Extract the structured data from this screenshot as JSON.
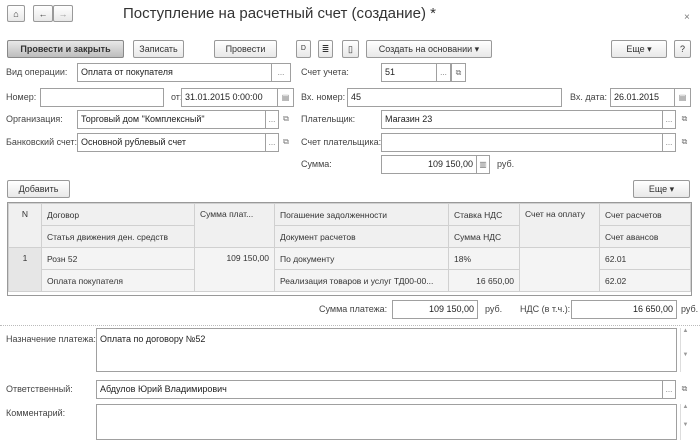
{
  "window": {
    "title": "Поступление на расчетный счет (создание) *",
    "close": "×"
  },
  "nav": {
    "home": "⌂",
    "back": "←",
    "forward": "→"
  },
  "toolbar": {
    "post_close": "Провести и закрыть",
    "save": "Записать",
    "post": "Провести",
    "create_based": "Создать на основании",
    "more": "Еще",
    "help": "?"
  },
  "form": {
    "operation_label": "Вид операции:",
    "operation": "Оплата от покупателя",
    "account_label": "Счет учета:",
    "account": "51",
    "number_label": "Номер:",
    "number": "",
    "from_label": "от:",
    "date": "31.01.2015  0:00:00",
    "in_number_label": "Вх. номер:",
    "in_number": "45",
    "in_date_label": "Вх. дата:",
    "in_date": "26.01.2015",
    "org_label": "Организация:",
    "org": "Торговый дом \"Комплексный\"",
    "payer_label": "Плательщик:",
    "payer": "Магазин 23",
    "bank_label": "Банковский счет:",
    "bank": "Основной рублевый счет",
    "payer_account_label": "Счет плательщика:",
    "payer_account": "",
    "sum_label": "Сумма:",
    "sum": "109 150,00",
    "currency": "руб."
  },
  "table_toolbar": {
    "add": "Добавить",
    "more": "Еще"
  },
  "table": {
    "headers": [
      [
        "N",
        "Договор",
        "Сумма плат...",
        "Погашение задолженности",
        "Ставка НДС",
        "Счет на оплату",
        "Счет расчетов"
      ],
      [
        "",
        "Статья движения ден. средств",
        "",
        "Документ расчетов",
        "Сумма НДС",
        "",
        "Счет авансов"
      ]
    ],
    "rows": [
      {
        "n": "1",
        "contract": "Розн 52",
        "amount": "109 150,00",
        "repayment": "По документу",
        "vat_rate": "18%",
        "invoice": "",
        "account": "62.01",
        "cashflow": "Оплата покупателя",
        "document": "Реализация товаров и услуг ТД00-00...",
        "vat_sum": "16 650,00",
        "advance_account": "62.02"
      }
    ]
  },
  "totals": {
    "payment_label": "Сумма платежа:",
    "payment": "109 150,00",
    "vat_label": "НДС (в т.ч.):",
    "vat": "16 650,00",
    "currency": "руб."
  },
  "footer": {
    "purpose_label": "Назначение платежа:",
    "purpose": "Оплата по договору №52",
    "responsible_label": "Ответственный:",
    "responsible": "Абдулов Юрий Владимирович",
    "comment_label": "Комментарий:",
    "comment": ""
  }
}
